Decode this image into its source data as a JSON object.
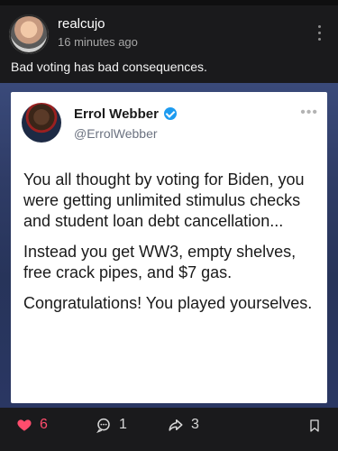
{
  "post": {
    "username": "realcujo",
    "timestamp": "16 minutes ago",
    "caption": "Bad voting has bad consequences."
  },
  "tweet": {
    "name": "Errol Webber",
    "handle": "@ErrolWebber",
    "paragraphs": [
      "You all thought by voting for Biden, you were getting unlimited stimulus checks and student loan debt cancellation...",
      "Instead you get WW3, empty shelves, free crack pipes, and $7 gas.",
      "Congratulations! You played yourselves."
    ]
  },
  "actions": {
    "likes": "6",
    "comments": "1",
    "shares": "3"
  },
  "icons": {
    "like": "heart-icon",
    "comment": "comment-icon",
    "share": "share-icon",
    "bookmark": "bookmark-icon",
    "more": "kebab-icon",
    "verified": "verified-badge-icon"
  },
  "colors": {
    "like": "#ff4d6d",
    "verified": "#1d9bf0",
    "background": "#1a1a1c"
  }
}
